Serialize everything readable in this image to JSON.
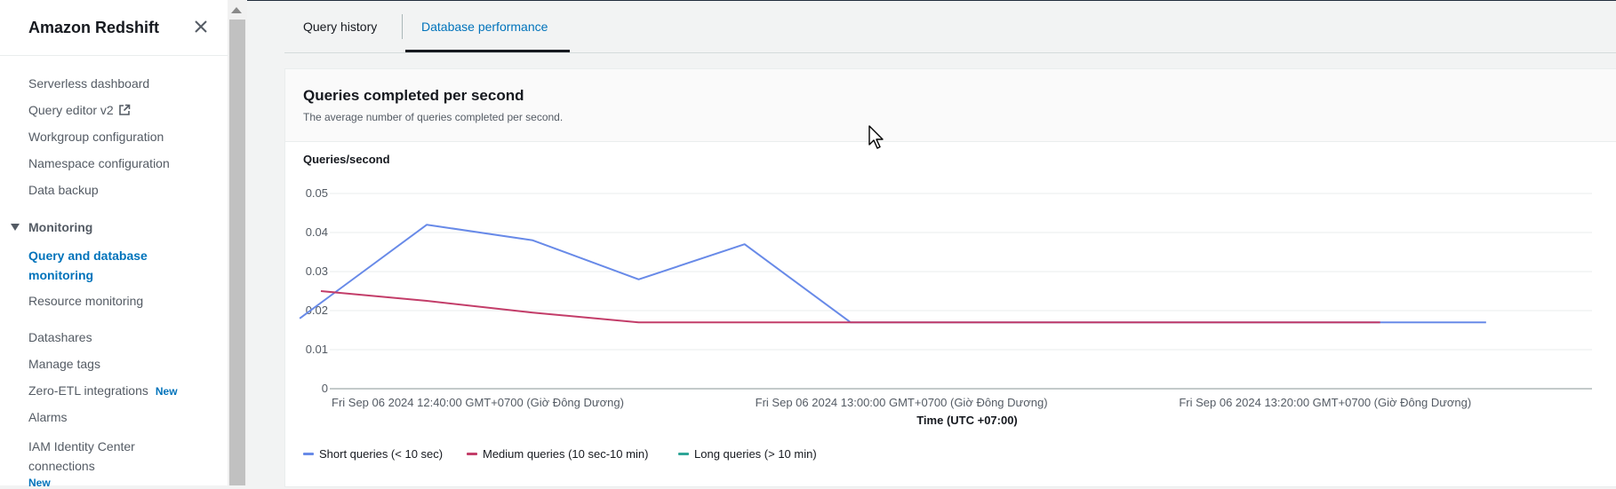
{
  "app": {
    "title": "Amazon Redshift"
  },
  "sidebar": {
    "items_top": [
      {
        "label": "Serverless dashboard"
      },
      {
        "label": "Query editor v2"
      },
      {
        "label": "Workgroup configuration"
      },
      {
        "label": "Namespace configuration"
      },
      {
        "label": "Data backup"
      }
    ],
    "section": {
      "label": "Monitoring"
    },
    "section_items": [
      {
        "label": "Query and database monitoring",
        "active": true
      },
      {
        "label": "Resource monitoring"
      }
    ],
    "items_bottom": [
      {
        "label": "Datashares"
      },
      {
        "label": "Manage tags"
      },
      {
        "label": "Zero-ETL integrations",
        "badge": "New"
      },
      {
        "label": "Alarms"
      },
      {
        "label": "IAM Identity Center connections",
        "badge": "New"
      }
    ]
  },
  "tabs": [
    {
      "label": "Query history",
      "active": false
    },
    {
      "label": "Database performance",
      "active": true
    }
  ],
  "panel": {
    "title": "Queries completed per second",
    "description": "The average number of queries completed per second."
  },
  "colors": {
    "short": "#688ae8",
    "medium": "#c33d69",
    "long": "#2ea597",
    "accent": "#0073bb"
  },
  "icons": [
    "close-icon",
    "external-link-icon",
    "caret-down-icon",
    "mouse-cursor-icon"
  ],
  "chart_data": {
    "type": "line",
    "ylabel": "Queries/second",
    "xlabel": "Time (UTC +07:00)",
    "ylim": [
      0,
      0.05
    ],
    "yticks": [
      "0.05",
      "0.04",
      "0.03",
      "0.02",
      "0.01",
      "0"
    ],
    "xticks": [
      "Fri Sep 06 2024 12:40:00 GMT+0700 (Giờ Đông Dương)",
      "Fri Sep 06 2024 13:00:00 GMT+0700 (Giờ Đông Dương)",
      "Fri Sep 06 2024 13:20:00 GMT+0700 (Giờ Đông Dương)"
    ],
    "xlim": [
      "12:40",
      "13:40"
    ],
    "grid": true,
    "legend_position": "bottom-left",
    "series": [
      {
        "name": "Short queries (< 10 sec)",
        "x": [
          "12:39",
          "12:45",
          "12:50",
          "12:55",
          "13:00",
          "13:05",
          "13:10",
          "13:15",
          "13:20",
          "13:25",
          "13:30",
          "13:35"
        ],
        "values": [
          0.018,
          0.042,
          0.038,
          0.028,
          0.037,
          0.017,
          0.017,
          0.017,
          0.017,
          0.017,
          0.017,
          0.017
        ]
      },
      {
        "name": "Medium queries (10 sec-10 min)",
        "x": [
          "12:40",
          "12:45",
          "12:50",
          "12:55",
          "13:00",
          "13:05",
          "13:10",
          "13:15",
          "13:20",
          "13:25",
          "13:30"
        ],
        "values": [
          0.025,
          0.0225,
          0.0195,
          0.017,
          0.017,
          0.017,
          0.017,
          0.017,
          0.017,
          0.017,
          0.017
        ]
      },
      {
        "name": "Long queries (> 10 min)",
        "x": [],
        "values": []
      }
    ]
  }
}
